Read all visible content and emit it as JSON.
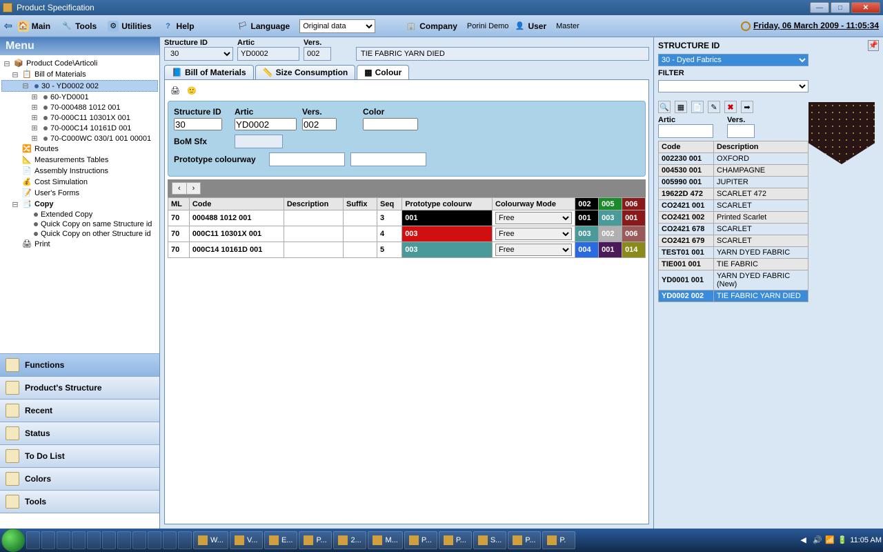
{
  "window": {
    "title": "Product Specification"
  },
  "menubar": {
    "main": "Main",
    "tools": "Tools",
    "utilities": "Utilities",
    "help": "Help",
    "language": "Language",
    "lang_value": "Original data",
    "company": "Company",
    "company_val": "Porini Demo",
    "user": "User",
    "user_val": "Master",
    "datetime": "Friday, 06 March 2009 - 11:05:34"
  },
  "sidebar": {
    "menu_title": "Menu",
    "tree": {
      "product_code": "Product Code\\Articoli",
      "bom": "Bill of Materials",
      "bom_sel": "30 - YD0002 002",
      "items": [
        "60-YD0001",
        "70-000488 1012   001",
        "70-000C11 10301X 001",
        "70-000C14 10161D 001",
        "70-C000WC 030/1  001 00001"
      ],
      "routes": "Routes",
      "meas": "Measurements Tables",
      "assy": "Assembly Instructions",
      "cost": "Cost Simulation",
      "forms": "User's Forms",
      "copy": "Copy",
      "copy_items": [
        "Extended Copy",
        "Quick Copy on same Structure id",
        "Quick Copy on other Structure id"
      ],
      "print": "Print"
    },
    "accordion": [
      "Functions",
      "Product's Structure",
      "Recent",
      "Status",
      "To Do List",
      "Colors",
      "Tools"
    ]
  },
  "header": {
    "structure_id_lbl": "Structure ID",
    "structure_id": "30",
    "artic_lbl": "Artic",
    "artic": "YD0002",
    "vers_lbl": "Vers.",
    "vers": "002",
    "description": "TIE FABRIC YARN DIED"
  },
  "tabs": {
    "bom": "Bill of Materials",
    "size": "Size Consumption",
    "colour": "Colour"
  },
  "form": {
    "structure_id_lbl": "Structure ID",
    "structure_id": "30",
    "artic_lbl": "Artic",
    "artic": "YD0002",
    "vers_lbl": "Vers.",
    "vers": "002",
    "color_lbl": "Color",
    "bom_sfx_lbl": "BoM Sfx",
    "proto_lbl": "Prototype colourway"
  },
  "grid": {
    "cols": [
      "ML",
      "Code",
      "Description",
      "Suffix",
      "Seq",
      "Prototype colourw",
      "Colourway Mode",
      "002",
      "005",
      "006"
    ],
    "colcols": [
      {
        "code": "002",
        "bg": "#000"
      },
      {
        "code": "005",
        "bg": "#1a8a2a"
      },
      {
        "code": "006",
        "bg": "#8a1a1a"
      }
    ],
    "rows": [
      {
        "ml": "70",
        "code": "000488 1012   001",
        "desc": "",
        "suf": "",
        "seq": "3",
        "proto": "001",
        "proto_bg": "#000",
        "mode": "Free",
        "cw": [
          {
            "v": "001",
            "bg": "#000"
          },
          {
            "v": "003",
            "bg": "#4a9a9a"
          },
          {
            "v": "001",
            "bg": "#8a1a1a"
          }
        ]
      },
      {
        "ml": "70",
        "code": "000C11 10301X 001",
        "desc": "",
        "suf": "",
        "seq": "4",
        "proto": "003",
        "proto_bg": "#d01010",
        "mode": "Free",
        "cw": [
          {
            "v": "003",
            "bg": "#4a9a9a"
          },
          {
            "v": "002",
            "bg": "#b0b0b0"
          },
          {
            "v": "006",
            "bg": "#9a5a5a"
          }
        ]
      },
      {
        "ml": "70",
        "code": "000C14 10161D 001",
        "desc": "",
        "suf": "",
        "seq": "5",
        "proto": "003",
        "proto_bg": "#4a9a9a",
        "mode": "Free",
        "cw": [
          {
            "v": "004",
            "bg": "#2a6ae0"
          },
          {
            "v": "001",
            "bg": "#4a1a5a"
          },
          {
            "v": "014",
            "bg": "#8a8a1a"
          }
        ]
      }
    ]
  },
  "right": {
    "structure_id_lbl": "STRUCTURE ID",
    "structure_sel": "30 - Dyed Fabrics",
    "filter_lbl": "FILTER",
    "artic_lbl": "Artic",
    "vers_lbl": "Vers.",
    "cols": {
      "code": "Code",
      "desc": "Description"
    },
    "rows": [
      {
        "code": "002230 001",
        "desc": "OXFORD"
      },
      {
        "code": "004530 001",
        "desc": "CHAMPAGNE"
      },
      {
        "code": "005990 001",
        "desc": "JUPITER"
      },
      {
        "code": "19622D 472",
        "desc": "SCARLET 472"
      },
      {
        "code": "CO2421 001",
        "desc": "SCARLET"
      },
      {
        "code": "CO2421 002",
        "desc": "Printed Scarlet"
      },
      {
        "code": "CO2421 678",
        "desc": "SCARLET"
      },
      {
        "code": "CO2421 679",
        "desc": "SCARLET"
      },
      {
        "code": "TEST01 001",
        "desc": "YARN DYED FABRIC"
      },
      {
        "code": "TIE001 001",
        "desc": "TIE FABRIC"
      },
      {
        "code": "YD0001 001",
        "desc": "YARN DYED FABRIC (New)"
      },
      {
        "code": "YD0002 002",
        "desc": "TIE FABRIC YARN DIED"
      }
    ],
    "sel_idx": 11
  },
  "taskbar": {
    "tasks": [
      "W...",
      "V...",
      "E...",
      "P...",
      "2...",
      "M...",
      "P...",
      "P...",
      "S...",
      "P...",
      "P."
    ],
    "clock": "11:05 AM"
  }
}
